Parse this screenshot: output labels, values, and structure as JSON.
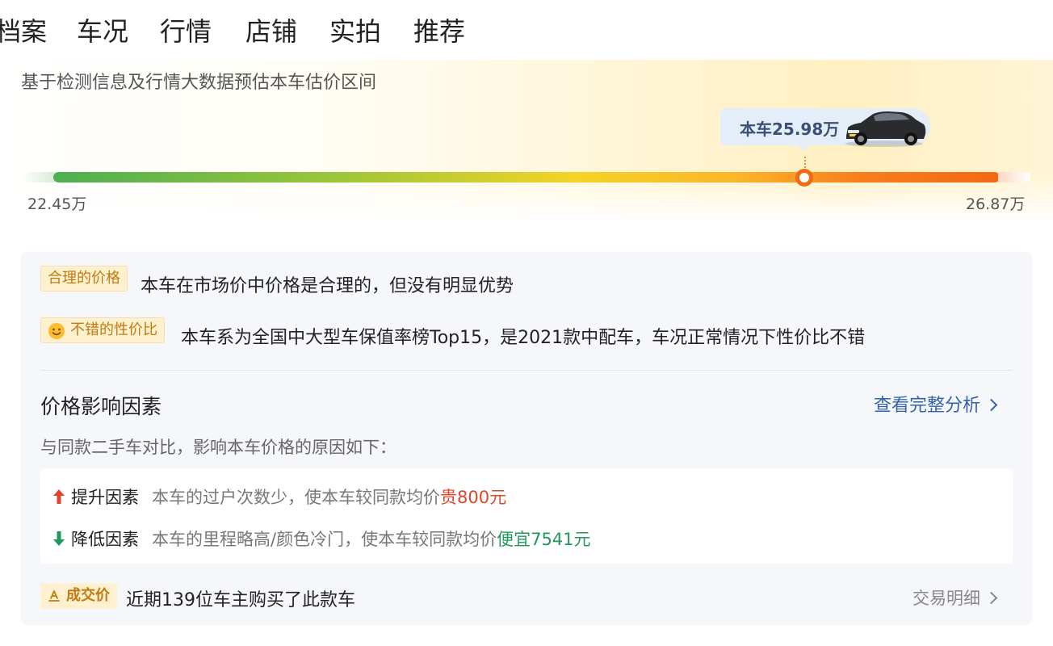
{
  "tabs": [
    {
      "label": "档案",
      "active": false
    },
    {
      "label": "车况",
      "active": false
    },
    {
      "label": "行情",
      "active": true
    },
    {
      "label": "店铺",
      "active": false
    },
    {
      "label": "实拍",
      "active": false
    },
    {
      "label": "推荐",
      "active": false
    }
  ],
  "valuation": {
    "subtitle": "基于检测信息及行情大数据预估本车估价区间",
    "current_price_label": "本车25.98万",
    "current_price": 25.98,
    "min_label": "22.45万",
    "max_label": "26.87万",
    "min": 22.45,
    "max": 26.87,
    "icon": "car-icon"
  },
  "assessments": [
    {
      "tag": "合理的价格",
      "text": "本车在市场价中价格是合理的，但没有明显优势"
    },
    {
      "tag": "不错的性价比",
      "tag_icon": "smile-icon",
      "text": "本车系为全国中大型车保值率榜Top15，是2021款中配车，车况正常情况下性价比不错"
    }
  ],
  "factors": {
    "title": "价格影响因素",
    "link": "查看完整分析",
    "subtitle": "与同款二手车对比，影响本车价格的原因如下：",
    "up": {
      "label": "提升因素",
      "desc": "本车的过户次数少，使本车较同款均价",
      "highlight": "贵800元"
    },
    "down": {
      "label": "降低因素",
      "desc": "本车的里程略高/颜色冷门，使本车较同款均价",
      "highlight": "便宜7541元"
    }
  },
  "deals": {
    "tag": "成交价",
    "text": "近期139位车主购买了此款车",
    "link": "交易明细"
  },
  "colors": {
    "accent_orange": "#f26913",
    "up_red": "#e0452c",
    "down_green": "#1f9a5a",
    "link_blue": "#3462a8",
    "tag_bg": "#fff1cf",
    "tag_text": "#c07a10"
  }
}
